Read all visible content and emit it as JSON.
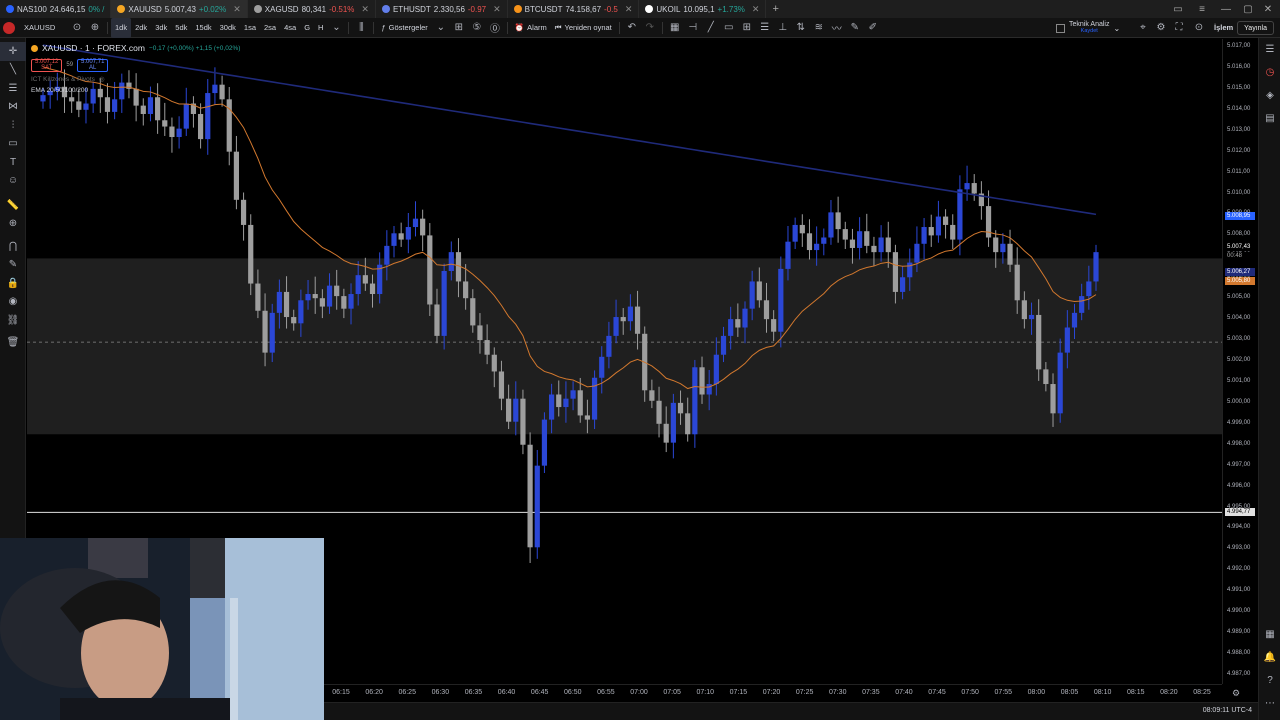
{
  "tabs": [
    {
      "name": "NAS100",
      "price": "24.646,15",
      "change": "0% /",
      "dir": "up",
      "color": "#2962ff",
      "active": false
    },
    {
      "name": "XAUUSD",
      "price": "5.007,43",
      "change": "+0.02%",
      "dir": "up",
      "color": "#f5a623",
      "active": true
    },
    {
      "name": "XAGUSD",
      "price": "80,341",
      "change": "-0.51%",
      "dir": "down",
      "color": "#9e9e9e",
      "active": false
    },
    {
      "name": "ETHUSDT",
      "price": "2.330,56",
      "change": "-0.97",
      "dir": "down",
      "color": "#627eea",
      "active": false
    },
    {
      "name": "BTCUSDT",
      "price": "74.158,67",
      "change": "-0.5",
      "dir": "down",
      "color": "#f7931a",
      "active": false
    },
    {
      "name": "UKOIL",
      "price": "10.095,1",
      "change": "+1.73%",
      "dir": "up",
      "color": "#ffffff",
      "active": false
    }
  ],
  "toolbar": {
    "symbol": "XAUUSD",
    "intervals": [
      "1dk",
      "2dk",
      "3dk",
      "5dk",
      "15dk",
      "30dk",
      "1sa",
      "2sa",
      "4sa",
      "G",
      "H"
    ],
    "active_interval": "1dk",
    "indicators_label": "Göstergeler",
    "alarm_label": "Alarm",
    "replay_label": "Yeniden oynat",
    "tech_analysis_label": "Teknik Analiz",
    "tech_analysis_sub": "Kaydet",
    "trade_label": "İşlem",
    "publish_label": "Yayınla"
  },
  "legend": {
    "title": "XAUUSD · 1 · FOREX.com",
    "change": "−0,17 (+0,00%)  +1,15 (+0,02%)",
    "sell_price": "5.007,12",
    "sell_label": "SAT",
    "spread": "59",
    "buy_price": "5.007,71",
    "buy_label": "AL",
    "indicator1": "ICT Killzones & Pivots",
    "indicator2": "EMA 20/50/100/200"
  },
  "price_axis": {
    "labels": [
      "5.017,00",
      "5.016,00",
      "5.015,00",
      "5.014,00",
      "5.013,00",
      "5.012,00",
      "5.011,00",
      "5.010,00",
      "5.009,00",
      "5.008,00",
      "5.007,00",
      "5.006,00",
      "5.005,00",
      "5.004,00",
      "5.003,00",
      "5.002,00",
      "5.001,00",
      "5.000,00",
      "4.999,00",
      "4.998,00",
      "4.997,00",
      "4.996,00",
      "4.995,00",
      "4.994,00",
      "4.993,00",
      "4.992,00",
      "4.991,00",
      "4.990,00",
      "4.989,00",
      "4.988,00",
      "4.987,00"
    ],
    "tag_blue": "5.008,95",
    "tag_last": "5.007,43",
    "tag_countdown": "00:48",
    "tag_navy": "5.006,27",
    "tag_orange": "5.005,80",
    "tag_white": "4.994,77"
  },
  "time_axis": [
    "06:15",
    "06:20",
    "06:25",
    "06:30",
    "06:35",
    "06:40",
    "06:45",
    "06:50",
    "06:55",
    "07:00",
    "07:05",
    "07:10",
    "07:15",
    "07:20",
    "07:25",
    "07:30",
    "07:35",
    "07:40",
    "07:45",
    "07:50",
    "07:55",
    "08:00",
    "08:05",
    "08:10",
    "08:15",
    "08:20",
    "08:25"
  ],
  "clock": "08:09:11 UTC-4",
  "colors": {
    "bull": "#2b47d6",
    "bear": "#9e9e9e",
    "ema_orange": "#d2782e",
    "ema_navy": "#1f2a7a",
    "zone": "#2a2a2a"
  },
  "chart_data": {
    "type": "candlestick",
    "symbol": "XAUUSD",
    "interval": "1 minute",
    "ylim": [
      4986.5,
      5017.2
    ],
    "zone": [
      4998.5,
      5006.9
    ],
    "hline": 4994.77,
    "dashed_line": 5002.9,
    "closes": [
      5014.7,
      5014.9,
      5015.1,
      5014.6,
      5014.4,
      5014.0,
      5014.3,
      5015.0,
      5014.6,
      5013.9,
      5014.5,
      5015.3,
      5015.0,
      5014.2,
      5013.8,
      5014.6,
      5013.5,
      5013.2,
      5012.7,
      5013.1,
      5014.3,
      5013.8,
      5012.6,
      5014.8,
      5015.2,
      5014.5,
      5012.0,
      5009.7,
      5008.5,
      5005.7,
      5004.4,
      5002.4,
      5004.3,
      5005.3,
      5004.1,
      5003.8,
      5004.9,
      5005.2,
      5005.0,
      5004.6,
      5005.6,
      5005.1,
      5004.5,
      5005.2,
      5006.1,
      5005.7,
      5005.2,
      5006.6,
      5007.5,
      5008.1,
      5007.8,
      5008.4,
      5008.8,
      5008.0,
      5004.7,
      5003.2,
      5006.3,
      5007.2,
      5005.8,
      5005.0,
      5003.7,
      5003.0,
      5002.3,
      5001.5,
      5000.2,
      4999.1,
      5000.2,
      4998.0,
      4993.1,
      4997.0,
      4999.2,
      5000.4,
      4999.8,
      5000.2,
      5000.6,
      4999.4,
      4999.2,
      5001.2,
      5002.2,
      5003.2,
      5004.1,
      5003.9,
      5004.6,
      5003.3,
      5000.6,
      5000.1,
      4999.0,
      4998.1,
      5000.0,
      4999.5,
      4998.5,
      5001.7,
      5000.4,
      5000.9,
      5002.3,
      5003.2,
      5004.0,
      5003.6,
      5004.5,
      5005.8,
      5004.9,
      5004.0,
      5003.4,
      5006.4,
      5007.7,
      5008.5,
      5008.1,
      5007.3,
      5007.6,
      5007.9,
      5009.1,
      5008.3,
      5007.8,
      5007.4,
      5008.2,
      5007.5,
      5007.2,
      5007.9,
      5007.2,
      5005.3,
      5006.0,
      5006.7,
      5007.6,
      5008.4,
      5008.0,
      5008.9,
      5008.5,
      5007.8,
      5010.2,
      5010.5,
      5010.0,
      5009.4,
      5007.9,
      5007.2,
      5007.6,
      5006.6,
      5004.9,
      5004.0,
      5004.2,
      5001.6,
      5000.9,
      4999.5,
      5002.4,
      5003.6,
      5004.3,
      5005.1,
      5005.8,
      5007.2
    ],
    "ema_orange": "≈5016 → 5003 → 5007 → 5005.8",
    "ema_navy": "≈5017 → 5010 → 5008.95"
  }
}
